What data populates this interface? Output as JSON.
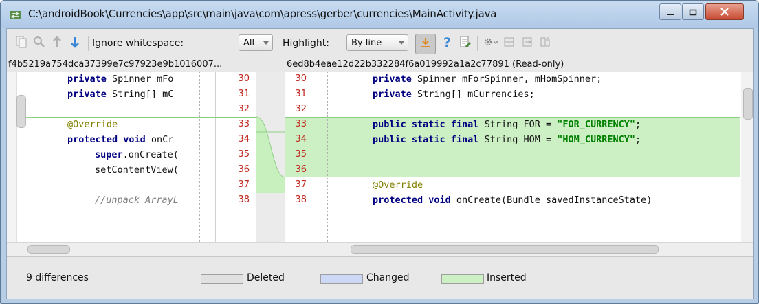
{
  "window": {
    "title": "C:\\androidBook\\Currencies\\app\\src\\main\\java\\com\\apress\\gerber\\currencies\\MainActivity.java"
  },
  "toolbar": {
    "ignore_whitespace_label": "Ignore whitespace:",
    "ignore_whitespace_value": "All",
    "highlight_label": "Highlight:",
    "highlight_value": "By line"
  },
  "left_pane": {
    "revision": "f4b5219a754dca37399e7c97923e9b1016007...",
    "lines": [
      {
        "num": "30",
        "code": "private Spinner mFo"
      },
      {
        "num": "31",
        "code": "private String[] mC"
      },
      {
        "num": "32",
        "code": ""
      },
      {
        "num": "33",
        "code": "@Override"
      },
      {
        "num": "34",
        "code": "protected void onCr"
      },
      {
        "num": "35",
        "code": "super.onCreate("
      },
      {
        "num": "36",
        "code": "setContentView("
      },
      {
        "num": "37",
        "code": ""
      },
      {
        "num": "38",
        "code": "//unpack ArrayL"
      }
    ]
  },
  "right_pane": {
    "revision": "6ed8b4eae12d22b332284f6a019992a1a2c77891 (Read-only)",
    "lines": [
      {
        "num": "30",
        "code": "private Spinner mForSpinner, mHomSpinner;"
      },
      {
        "num": "31",
        "code": "private String[] mCurrencies;"
      },
      {
        "num": "32",
        "code": ""
      },
      {
        "num": "33",
        "code": "public static final String FOR = \"FOR_CURRENCY\";"
      },
      {
        "num": "34",
        "code": "public static final String HOM = \"HOM_CURRENCY\";"
      },
      {
        "num": "35",
        "code": ""
      },
      {
        "num": "36",
        "code": ""
      },
      {
        "num": "37",
        "code": "@Override"
      },
      {
        "num": "38",
        "code": "protected void onCreate(Bundle savedInstanceState)"
      }
    ]
  },
  "status": {
    "differences": "9 differences",
    "legend_deleted": "Deleted",
    "legend_changed": "Changed",
    "legend_inserted": "Inserted"
  },
  "colors": {
    "inserted": "#ccf0c4",
    "deleted": "#e0e0e0",
    "changed": "#ccd8f5",
    "line_number": "#c0281f"
  }
}
